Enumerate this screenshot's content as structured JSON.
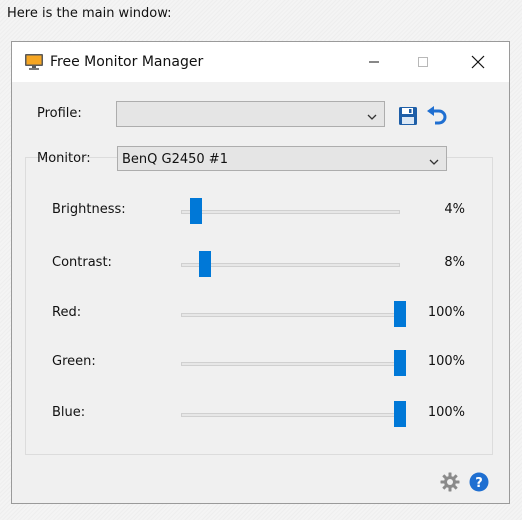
{
  "caption": "Here is the main window:",
  "window": {
    "title": "Free Monitor Manager",
    "controls": {
      "minimize": "—",
      "maximize": "☐",
      "close": "✕"
    }
  },
  "profile": {
    "label": "Profile:",
    "value": ""
  },
  "monitor": {
    "label": "Monitor:",
    "value": "BenQ G2450 #1"
  },
  "sliders": [
    {
      "label": "Brightness:",
      "value": 4,
      "display": "4%"
    },
    {
      "label": "Contrast:",
      "value": 8,
      "display": "8%"
    },
    {
      "label": "Red:",
      "value": 100,
      "display": "100%"
    },
    {
      "label": "Green:",
      "value": 100,
      "display": "100%"
    },
    {
      "label": "Blue:",
      "value": 100,
      "display": "100%"
    }
  ],
  "icons": {
    "app": "monitor-icon",
    "save": "save-icon",
    "undo": "undo-icon",
    "settings": "gear-icon",
    "help": "help-icon"
  },
  "colors": {
    "accent": "#0078d7",
    "window_bg": "#f0f0f0",
    "titlebar_bg": "#ffffff"
  }
}
